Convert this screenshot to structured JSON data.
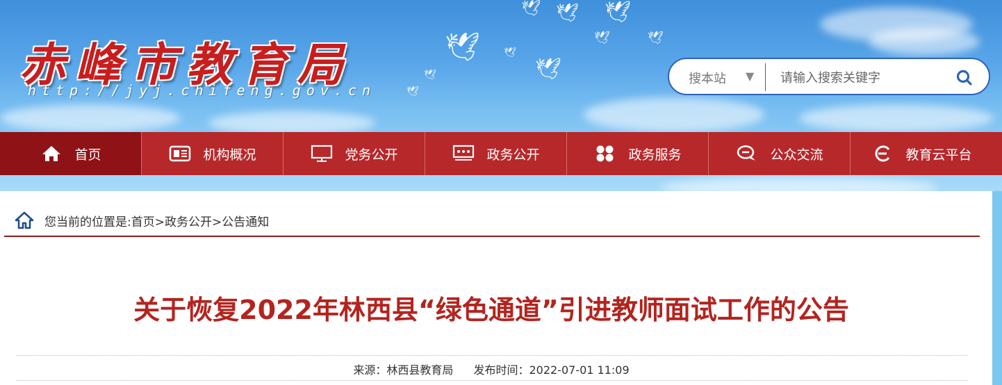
{
  "site": {
    "title": "赤峰市教育局",
    "url": "http://jyj.chifeng.gov.cn"
  },
  "search": {
    "scope_label": "搜本站",
    "placeholder": "请输入搜索关键字"
  },
  "nav": {
    "items": [
      {
        "label": "首页",
        "icon": "home-icon",
        "active": true
      },
      {
        "label": "机构概况",
        "icon": "document-icon"
      },
      {
        "label": "党务公开",
        "icon": "monitor-icon"
      },
      {
        "label": "政务公开",
        "icon": "presentation-icon"
      },
      {
        "label": "政务服务",
        "icon": "grid-icon"
      },
      {
        "label": "公众交流",
        "icon": "chat-icon"
      },
      {
        "label": "教育云平台",
        "icon": "cloud-e-icon"
      }
    ]
  },
  "breadcrumb": {
    "prefix": "您当前的位置是:",
    "path": "首页>政务公开>公告通知"
  },
  "article": {
    "title": "关于恢复2022年林西县“绿色通道”引进教师面试工作的公告",
    "source": "来源：林西县教育局",
    "publish_time": "发布时间：2022-07-01 11:09"
  },
  "colors": {
    "nav_bg": "#b7282b",
    "nav_active": "#8e1216",
    "title_red": "#b3241f"
  }
}
